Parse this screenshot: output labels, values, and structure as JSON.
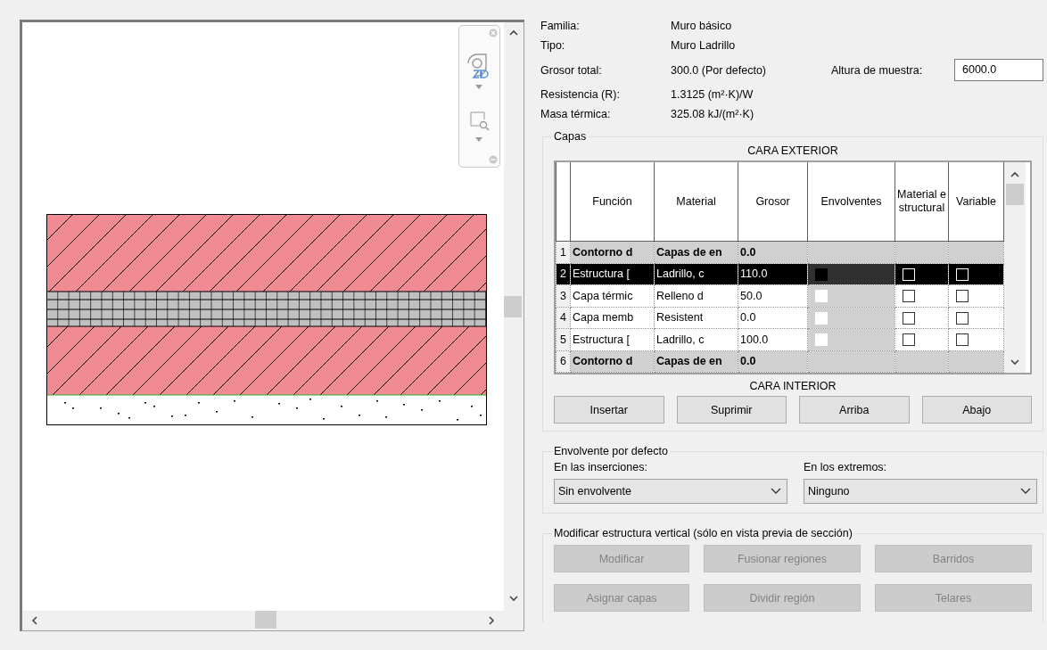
{
  "properties": [
    {
      "label": "Familia:",
      "value": "Muro básico"
    },
    {
      "label": "Tipo:",
      "value": "Muro Ladrillo"
    },
    {
      "label": "Grosor total:",
      "value": "300.0 (Por defecto)"
    },
    {
      "label": "Resistencia (R):",
      "value": "1.3125 (m²·K)/W"
    },
    {
      "label": "Masa térmica:",
      "value": "325.08 kJ/(m²·K)"
    }
  ],
  "sample_height": {
    "label": "Altura de muestra:",
    "value": "6000.0"
  },
  "layers": {
    "title": "Capas",
    "top_caption": "CARA EXTERIOR",
    "bottom_caption": "CARA INTERIOR",
    "columns": [
      "Función",
      "Material",
      "Grosor",
      "Envolventes",
      "Material estructural",
      "Variable"
    ],
    "rows": [
      {
        "kind": "boundary",
        "number": "1",
        "function": "Contorno d",
        "material": "Capas de en",
        "thickness": "0.0",
        "selected": false
      },
      {
        "kind": "layer",
        "number": "2",
        "function": "Estructura [",
        "material": "Ladrillo, c",
        "thickness": "110.0",
        "selected": true,
        "wraps": false,
        "structural": false,
        "variable": false
      },
      {
        "kind": "layer",
        "number": "3",
        "function": "Capa térmic",
        "material": "Relleno d",
        "thickness": "50.0",
        "selected": false,
        "wraps": false,
        "structural": false,
        "variable": false
      },
      {
        "kind": "layer",
        "number": "4",
        "function": "Capa memb",
        "material": "Resistent",
        "thickness": "0.0",
        "selected": false,
        "wraps": false,
        "structural": false,
        "variable": false
      },
      {
        "kind": "layer",
        "number": "5",
        "function": "Estructura [",
        "material": "Ladrillo, c",
        "thickness": "100.0",
        "selected": false,
        "wraps": false,
        "structural": false,
        "variable": false
      },
      {
        "kind": "boundary",
        "number": "6",
        "function": "Contorno d",
        "material": "Capas de en",
        "thickness": "0.0",
        "selected": false
      }
    ],
    "buttons": [
      "Insertar",
      "Suprimir",
      "Arriba",
      "Abajo"
    ]
  },
  "default_wrapping": {
    "title": "Envolvente por defecto",
    "fields": [
      {
        "label": "En las inserciones:",
        "value": "Sin envolvente"
      },
      {
        "label": "En los extremos:",
        "value": "Ninguno"
      }
    ]
  },
  "vertical_structure": {
    "title": "Modificar estructura vertical (sólo en vista previa de sección)",
    "buttons": [
      {
        "label": "Modificar",
        "disabled": true
      },
      {
        "label": "Fusionar regiones",
        "disabled": true
      },
      {
        "label": "Barridos",
        "disabled": true
      },
      {
        "label": "Asignar capas",
        "disabled": true
      },
      {
        "label": "Dividir región",
        "disabled": true
      },
      {
        "label": "Telares",
        "disabled": true
      }
    ]
  }
}
